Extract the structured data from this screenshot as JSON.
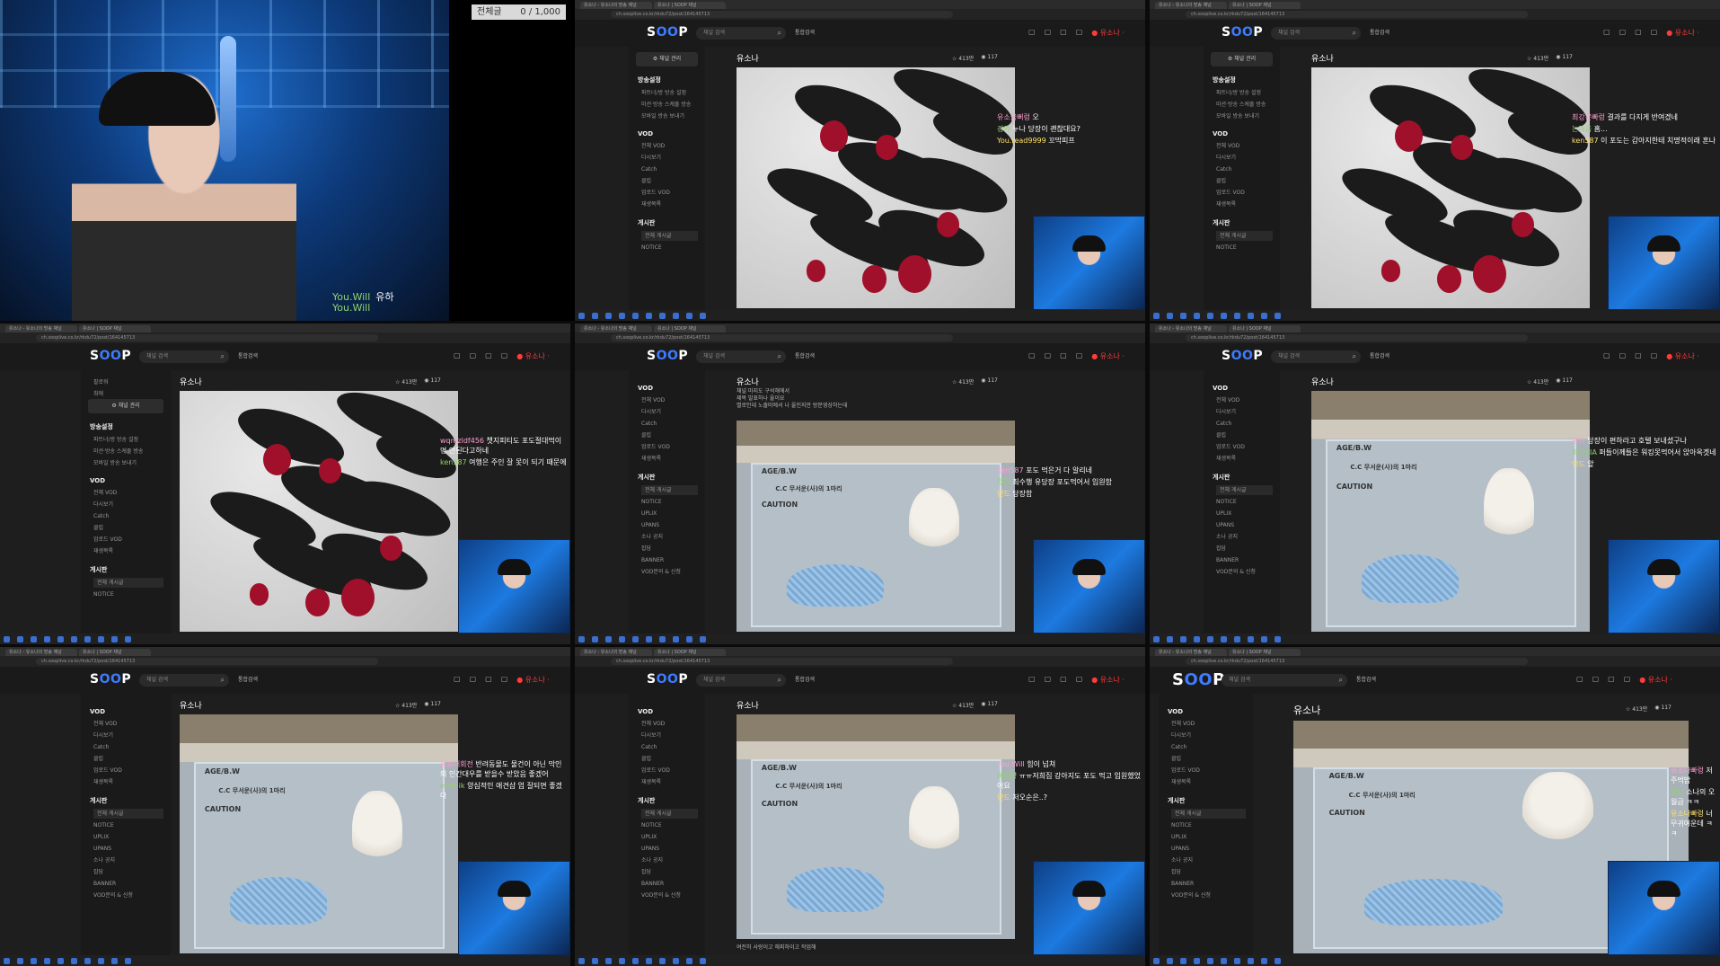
{
  "webcam": {
    "counter_label": "전체글",
    "counter_value": "0 / 1,000",
    "chat": [
      {
        "nick": "You.Will",
        "msg": "유하"
      },
      {
        "nick": "You.Will",
        "msg": ""
      }
    ]
  },
  "browser": {
    "tab1": "유소나 - 유소나의 방송 채널",
    "tab2": "유소나 | SOOP 채널",
    "url": "ch.sooplive.co.kr/rkdu72/post/164145713",
    "logo_a": "S",
    "logo_o": "OO",
    "logo_p": "P",
    "search_placeholder": "채널 검색",
    "search_tab": "통합검색",
    "live_label": "● 유소나 ·",
    "channel_btn": "⚙ 채널 관리",
    "page_title": "유소나",
    "likes": "☆ 413만",
    "views": "◉ 117"
  },
  "sidebar": {
    "section_broadcast": "방송설정",
    "broadcast_items": [
      "파트너/방 방송 설정",
      "미션·방송 스케줄 방송",
      "모바일 방송 보내기"
    ],
    "section_vod": "VOD",
    "vod_items": [
      "전체 VOD",
      "다시보기",
      "Catch",
      "클립",
      "업로드 VOD",
      "재생목록"
    ],
    "section_board": "게시판",
    "board_items": [
      "전체 게시글",
      "NOTICE",
      "UPLIX",
      "UPANS",
      "소나 공지",
      "잡담",
      "BANNER",
      "VOD문의 & 신청"
    ],
    "owner_items": [
      "팔로워",
      "최애"
    ]
  },
  "post_desc": [
    "채널 마지도 구석해에서",
    "제목 발표하나 울이요",
    "별로인데 노출마에서 나 울인지만 방문영상하는데"
  ],
  "post_footer": "여전히 사랑이고 해피하이고 작업해",
  "chats": {
    "c2": [
      {
        "nick": "유소울뻐렁",
        "msg": "오"
      },
      {
        "nick": "강카",
        "msg": "누나 당장이 괜찮대요?"
      },
      {
        "nick": "You.read9999",
        "msg": "꼬막피프"
      }
    ],
    "c3": [
      {
        "nick": "최강운빠렁",
        "msg": "결과를 다지게 반여겠네"
      },
      {
        "nick": "논마음",
        "msg": "홈..."
      },
      {
        "nick": "ken587",
        "msg": "이 포도는 감아지한테 치명적이래 혼나"
      }
    ],
    "c4": [
      {
        "nick": "wqmzldf456",
        "msg": "챗지피티도 포도절대먹이면 안된다고하네"
      },
      {
        "nick": "ken587",
        "msg": "여행은 주인 잘 못이 되기 때문에"
      }
    ],
    "c5": [
      {
        "nick": "ken587",
        "msg": "포도 먹은거 다 알리네"
      },
      {
        "nick": "검연",
        "msg": "최수행 유당장 포도먹어서 입원함"
      },
      {
        "nick": "앤드",
        "msg": "당장함"
      }
    ],
    "c6": [
      {
        "nick": "용카",
        "msg": "당장이 편하라고 호텔 보내셨구나"
      },
      {
        "nick": "최강KIA",
        "msg": "퍼들이께들은 워킹못먹어서 앉아옥겟네"
      },
      {
        "nick": "앤드",
        "msg": "앝"
      }
    ],
    "c7": [
      {
        "nick": "유로대회전",
        "msg": "반려동물도 물건이 아닌 막인의 인간대우를 받을수 받았음 좋겠어"
      },
      {
        "nick": "mumik",
        "msg": "양심적인 애견샵 업 잘되면 좋겠다"
      }
    ],
    "c8": [
      {
        "nick": "You.Will",
        "msg": "힘이 넘쳐"
      },
      {
        "nick": "혜라양",
        "msg": "ㅠㅠ저희집 강아지도 포도 먹고 입원했었어요"
      },
      {
        "nick": "앤드",
        "msg": "저오순은..?"
      }
    ],
    "c9": [
      {
        "nick": "유소나빠렁",
        "msg": "저 주먹밥"
      },
      {
        "nick": "앤드",
        "msg": "소나의 오월급 ㅋㅋ"
      },
      {
        "nick": "유소나빠렁",
        "msg": "너무귀여운데 ㅋㅋ"
      }
    ]
  },
  "cage_sign_1": "AGE/B.W",
  "cage_sign_2": "C.C 무서운(사)의 1마리",
  "cage_sign_3": "CAUTION"
}
